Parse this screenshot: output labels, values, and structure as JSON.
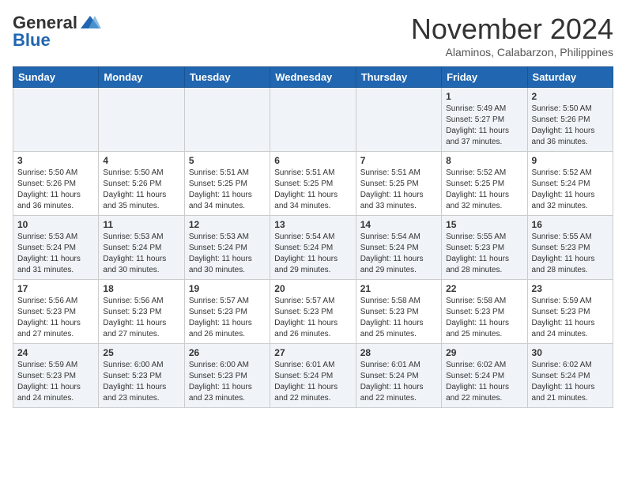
{
  "header": {
    "logo_general": "General",
    "logo_blue": "Blue",
    "month_year": "November 2024",
    "location": "Alaminos, Calabarzon, Philippines"
  },
  "weekdays": [
    "Sunday",
    "Monday",
    "Tuesday",
    "Wednesday",
    "Thursday",
    "Friday",
    "Saturday"
  ],
  "weeks": [
    [
      {
        "day": "",
        "info": ""
      },
      {
        "day": "",
        "info": ""
      },
      {
        "day": "",
        "info": ""
      },
      {
        "day": "",
        "info": ""
      },
      {
        "day": "",
        "info": ""
      },
      {
        "day": "1",
        "info": "Sunrise: 5:49 AM\nSunset: 5:27 PM\nDaylight: 11 hours\nand 37 minutes."
      },
      {
        "day": "2",
        "info": "Sunrise: 5:50 AM\nSunset: 5:26 PM\nDaylight: 11 hours\nand 36 minutes."
      }
    ],
    [
      {
        "day": "3",
        "info": "Sunrise: 5:50 AM\nSunset: 5:26 PM\nDaylight: 11 hours\nand 36 minutes."
      },
      {
        "day": "4",
        "info": "Sunrise: 5:50 AM\nSunset: 5:26 PM\nDaylight: 11 hours\nand 35 minutes."
      },
      {
        "day": "5",
        "info": "Sunrise: 5:51 AM\nSunset: 5:25 PM\nDaylight: 11 hours\nand 34 minutes."
      },
      {
        "day": "6",
        "info": "Sunrise: 5:51 AM\nSunset: 5:25 PM\nDaylight: 11 hours\nand 34 minutes."
      },
      {
        "day": "7",
        "info": "Sunrise: 5:51 AM\nSunset: 5:25 PM\nDaylight: 11 hours\nand 33 minutes."
      },
      {
        "day": "8",
        "info": "Sunrise: 5:52 AM\nSunset: 5:25 PM\nDaylight: 11 hours\nand 32 minutes."
      },
      {
        "day": "9",
        "info": "Sunrise: 5:52 AM\nSunset: 5:24 PM\nDaylight: 11 hours\nand 32 minutes."
      }
    ],
    [
      {
        "day": "10",
        "info": "Sunrise: 5:53 AM\nSunset: 5:24 PM\nDaylight: 11 hours\nand 31 minutes."
      },
      {
        "day": "11",
        "info": "Sunrise: 5:53 AM\nSunset: 5:24 PM\nDaylight: 11 hours\nand 30 minutes."
      },
      {
        "day": "12",
        "info": "Sunrise: 5:53 AM\nSunset: 5:24 PM\nDaylight: 11 hours\nand 30 minutes."
      },
      {
        "day": "13",
        "info": "Sunrise: 5:54 AM\nSunset: 5:24 PM\nDaylight: 11 hours\nand 29 minutes."
      },
      {
        "day": "14",
        "info": "Sunrise: 5:54 AM\nSunset: 5:24 PM\nDaylight: 11 hours\nand 29 minutes."
      },
      {
        "day": "15",
        "info": "Sunrise: 5:55 AM\nSunset: 5:23 PM\nDaylight: 11 hours\nand 28 minutes."
      },
      {
        "day": "16",
        "info": "Sunrise: 5:55 AM\nSunset: 5:23 PM\nDaylight: 11 hours\nand 28 minutes."
      }
    ],
    [
      {
        "day": "17",
        "info": "Sunrise: 5:56 AM\nSunset: 5:23 PM\nDaylight: 11 hours\nand 27 minutes."
      },
      {
        "day": "18",
        "info": "Sunrise: 5:56 AM\nSunset: 5:23 PM\nDaylight: 11 hours\nand 27 minutes."
      },
      {
        "day": "19",
        "info": "Sunrise: 5:57 AM\nSunset: 5:23 PM\nDaylight: 11 hours\nand 26 minutes."
      },
      {
        "day": "20",
        "info": "Sunrise: 5:57 AM\nSunset: 5:23 PM\nDaylight: 11 hours\nand 26 minutes."
      },
      {
        "day": "21",
        "info": "Sunrise: 5:58 AM\nSunset: 5:23 PM\nDaylight: 11 hours\nand 25 minutes."
      },
      {
        "day": "22",
        "info": "Sunrise: 5:58 AM\nSunset: 5:23 PM\nDaylight: 11 hours\nand 25 minutes."
      },
      {
        "day": "23",
        "info": "Sunrise: 5:59 AM\nSunset: 5:23 PM\nDaylight: 11 hours\nand 24 minutes."
      }
    ],
    [
      {
        "day": "24",
        "info": "Sunrise: 5:59 AM\nSunset: 5:23 PM\nDaylight: 11 hours\nand 24 minutes."
      },
      {
        "day": "25",
        "info": "Sunrise: 6:00 AM\nSunset: 5:23 PM\nDaylight: 11 hours\nand 23 minutes."
      },
      {
        "day": "26",
        "info": "Sunrise: 6:00 AM\nSunset: 5:23 PM\nDaylight: 11 hours\nand 23 minutes."
      },
      {
        "day": "27",
        "info": "Sunrise: 6:01 AM\nSunset: 5:24 PM\nDaylight: 11 hours\nand 22 minutes."
      },
      {
        "day": "28",
        "info": "Sunrise: 6:01 AM\nSunset: 5:24 PM\nDaylight: 11 hours\nand 22 minutes."
      },
      {
        "day": "29",
        "info": "Sunrise: 6:02 AM\nSunset: 5:24 PM\nDaylight: 11 hours\nand 22 minutes."
      },
      {
        "day": "30",
        "info": "Sunrise: 6:02 AM\nSunset: 5:24 PM\nDaylight: 11 hours\nand 21 minutes."
      }
    ]
  ]
}
